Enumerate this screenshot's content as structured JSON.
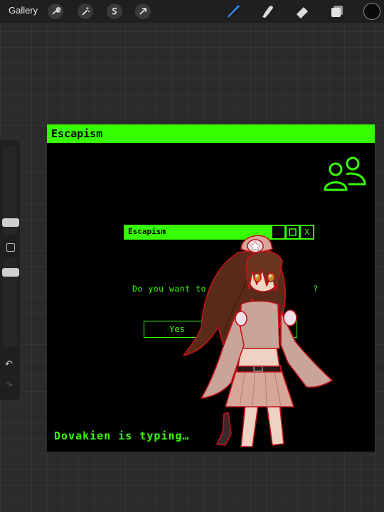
{
  "toolbar": {
    "gallery_label": "Gallery",
    "actions": [
      {
        "icon": "wrench-icon"
      },
      {
        "icon": "magic-wand-icon"
      },
      {
        "icon": "selection-icon"
      },
      {
        "icon": "transform-arrow-icon"
      }
    ],
    "tools": [
      {
        "icon": "brush-icon",
        "active": true,
        "color": "#2f8cff"
      },
      {
        "icon": "smudge-icon",
        "active": false
      },
      {
        "icon": "eraser-icon",
        "active": false
      },
      {
        "icon": "layers-icon",
        "active": false
      }
    ],
    "current_color": "#0a0a0a"
  },
  "sidebar": {
    "brush_size_icon": "slider-knob",
    "opacity_icon": "slider-knob",
    "modify_icon": "square-icon",
    "undo_icon": "undo-icon",
    "redo_icon": "redo-icon"
  },
  "artwork": {
    "window_title": "Escapism",
    "dialog_title": "Escapism",
    "dialog_buttons": {
      "minimize": "",
      "maximize": "",
      "close": "X"
    },
    "dialog_question": "Do you want to en",
    "dialog_question_tail": "?",
    "yes_label": "Yes",
    "no_label": "",
    "typing_text": "Dovakien is typing…",
    "accent_color": "#38ff00",
    "background_color": "#000000"
  }
}
